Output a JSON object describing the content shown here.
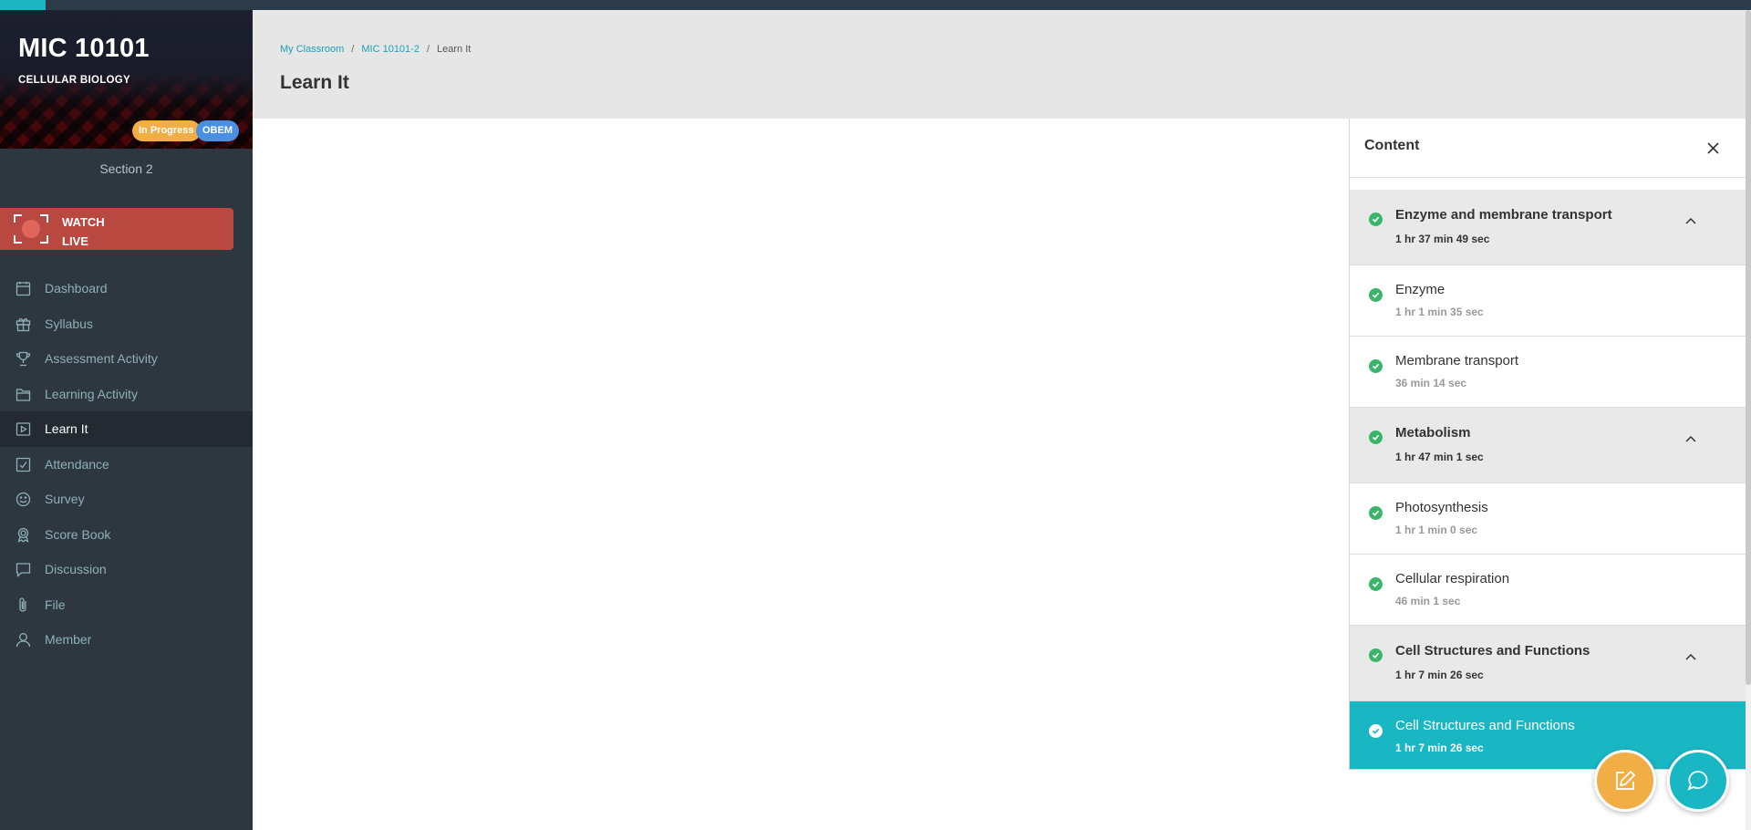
{
  "colors": {
    "accent": "#19b6c3",
    "sidebar_bg": "#2d3740",
    "watch_live_bg": "#b94840",
    "badge_in_progress": "#f0ae45",
    "badge_obem": "#4a90e2",
    "check_green": "#3bb56b",
    "note_fab": "#f0ae45"
  },
  "progress": {
    "fraction": 0.026
  },
  "course": {
    "code": "MIC 10101",
    "name": "CELLULAR BIOLOGY",
    "status_badge": "In Progress",
    "program_badge": "OBEM",
    "section": "Section 2"
  },
  "watch_live": {
    "label_line1": "WATCH",
    "label_line2": "LIVE",
    "icon": "live-camera-icon"
  },
  "nav": [
    {
      "label": "Dashboard",
      "icon": "calendar-icon",
      "active": false
    },
    {
      "label": "Syllabus",
      "icon": "gift-icon",
      "active": false
    },
    {
      "label": "Assessment Activity",
      "icon": "trophy-icon",
      "active": false
    },
    {
      "label": "Learning Activity",
      "icon": "folder-icon",
      "active": false
    },
    {
      "label": "Learn It",
      "icon": "play-icon",
      "active": true
    },
    {
      "label": "Attendance",
      "icon": "checkbox-icon",
      "active": false
    },
    {
      "label": "Survey",
      "icon": "smile-icon",
      "active": false
    },
    {
      "label": "Score Book",
      "icon": "award-icon",
      "active": false
    },
    {
      "label": "Discussion",
      "icon": "message-icon",
      "active": false
    },
    {
      "label": "File",
      "icon": "paperclip-icon",
      "active": false
    },
    {
      "label": "Member",
      "icon": "user-icon",
      "active": false
    }
  ],
  "breadcrumb": {
    "item1": "My Classroom",
    "item2": "MIC 10101-2",
    "current": "Learn It",
    "separator": "/"
  },
  "page": {
    "title": "Learn It"
  },
  "content_panel": {
    "title": "Content",
    "items": [
      {
        "kind": "group",
        "title": "Enzyme and membrane transport",
        "duration": "1 hr 37 min 49 sec",
        "expanded": true,
        "selected": false
      },
      {
        "kind": "lesson",
        "title": "Enzyme",
        "duration": "1 hr 1 min 35 sec",
        "selected": false
      },
      {
        "kind": "lesson",
        "title": "Membrane transport",
        "duration": "36 min 14 sec",
        "selected": false
      },
      {
        "kind": "group",
        "title": "Metabolism",
        "duration": "1 hr 47 min 1 sec",
        "expanded": true,
        "selected": false
      },
      {
        "kind": "lesson",
        "title": "Photosynthesis",
        "duration": "1 hr 1 min 0 sec",
        "selected": false
      },
      {
        "kind": "lesson",
        "title": "Cellular respiration",
        "duration": "46 min 1 sec",
        "selected": false
      },
      {
        "kind": "group",
        "title": "Cell Structures and Functions",
        "duration": "1 hr 7 min 26 sec",
        "expanded": true,
        "selected": false
      },
      {
        "kind": "lesson",
        "title": "Cell Structures and Functions",
        "duration": "1 hr 7 min 26 sec",
        "selected": true
      }
    ]
  },
  "fabs": {
    "note_icon": "edit-note-icon",
    "chat_icon": "chat-bubble-icon"
  }
}
